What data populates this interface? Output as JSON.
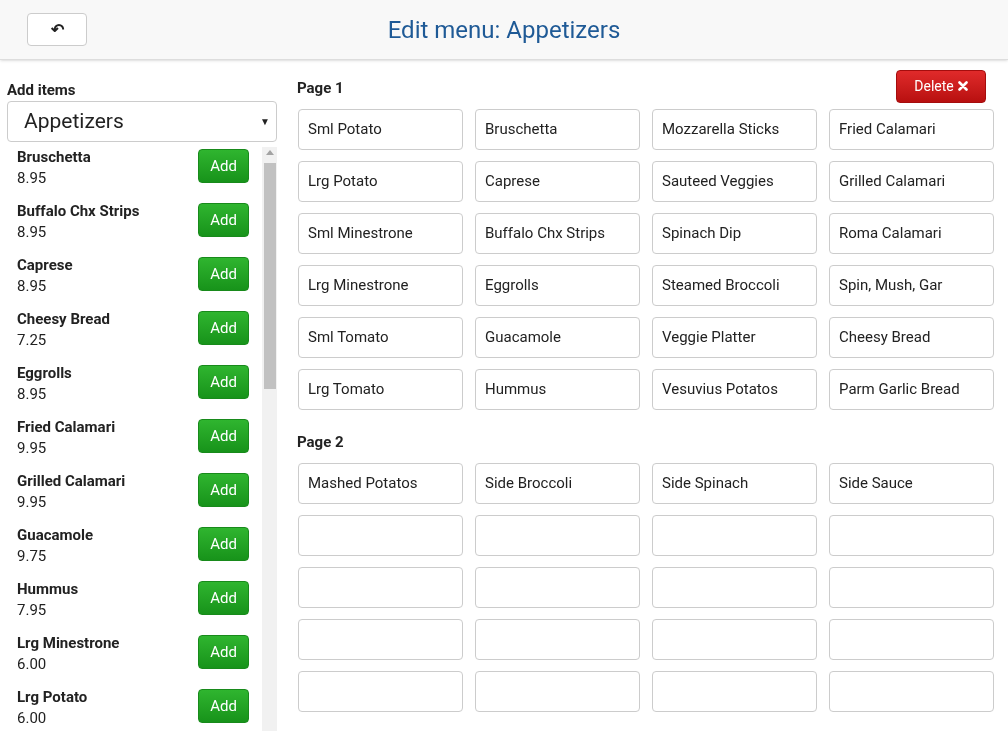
{
  "header": {
    "back_icon": "↶",
    "title": "Edit menu: Appetizers"
  },
  "sidebar": {
    "label": "Add items",
    "category": "Appetizers",
    "caret": "▼",
    "items": [
      {
        "name": "Bruschetta",
        "price": "8.95",
        "add_label": "Add"
      },
      {
        "name": "Buffalo Chx Strips",
        "price": "8.95",
        "add_label": "Add"
      },
      {
        "name": "Caprese",
        "price": "8.95",
        "add_label": "Add"
      },
      {
        "name": "Cheesy Bread",
        "price": "7.25",
        "add_label": "Add"
      },
      {
        "name": "Eggrolls",
        "price": "8.95",
        "add_label": "Add"
      },
      {
        "name": "Fried Calamari",
        "price": "9.95",
        "add_label": "Add"
      },
      {
        "name": "Grilled Calamari",
        "price": "9.95",
        "add_label": "Add"
      },
      {
        "name": "Guacamole",
        "price": "9.75",
        "add_label": "Add"
      },
      {
        "name": "Hummus",
        "price": "7.95",
        "add_label": "Add"
      },
      {
        "name": "Lrg Minestrone",
        "price": "6.00",
        "add_label": "Add"
      },
      {
        "name": "Lrg Potato",
        "price": "6.00",
        "add_label": "Add"
      }
    ]
  },
  "delete_button": {
    "label": "Delete"
  },
  "pages": [
    {
      "title": "Page 1",
      "cells": [
        {
          "kind": "item",
          "label": "Sml Potato"
        },
        {
          "kind": "item",
          "label": "Bruschetta"
        },
        {
          "kind": "item",
          "label": "Mozzarella Sticks"
        },
        {
          "kind": "item",
          "label": "Fried Calamari"
        },
        {
          "kind": "item",
          "label": "Lrg Potato"
        },
        {
          "kind": "item",
          "label": "Caprese"
        },
        {
          "kind": "item",
          "label": "Sauteed Veggies"
        },
        {
          "kind": "item",
          "label": "Grilled Calamari"
        },
        {
          "kind": "item",
          "label": "Sml Minestrone"
        },
        {
          "kind": "item",
          "label": "Buffalo Chx Strips"
        },
        {
          "kind": "item",
          "label": "Spinach Dip"
        },
        {
          "kind": "item",
          "label": "Roma Calamari"
        },
        {
          "kind": "item",
          "label": "Lrg Minestrone"
        },
        {
          "kind": "item",
          "label": "Eggrolls"
        },
        {
          "kind": "item",
          "label": "Steamed Broccoli"
        },
        {
          "kind": "item",
          "label": "Spin, Mush, Gar"
        },
        {
          "kind": "item",
          "label": "Sml Tomato"
        },
        {
          "kind": "item",
          "label": "Guacamole"
        },
        {
          "kind": "item",
          "label": "Veggie Platter"
        },
        {
          "kind": "item",
          "label": "Cheesy Bread"
        },
        {
          "kind": "item",
          "label": "Lrg Tomato"
        },
        {
          "kind": "item",
          "label": "Hummus"
        },
        {
          "kind": "item",
          "label": "Vesuvius Potatos"
        },
        {
          "kind": "item",
          "label": "Parm Garlic Bread"
        }
      ]
    },
    {
      "title": "Page 2",
      "cells": [
        {
          "kind": "item",
          "label": "Mashed Potatos"
        },
        {
          "kind": "item",
          "label": "Side Broccoli"
        },
        {
          "kind": "item",
          "label": "Side Spinach"
        },
        {
          "kind": "item",
          "label": "Side Sauce"
        },
        {
          "kind": "empty"
        },
        {
          "kind": "empty"
        },
        {
          "kind": "empty"
        },
        {
          "kind": "empty"
        },
        {
          "kind": "empty"
        },
        {
          "kind": "empty"
        },
        {
          "kind": "empty"
        },
        {
          "kind": "empty"
        },
        {
          "kind": "empty"
        },
        {
          "kind": "empty"
        },
        {
          "kind": "empty"
        },
        {
          "kind": "empty"
        },
        {
          "kind": "empty"
        },
        {
          "kind": "empty"
        },
        {
          "kind": "empty"
        },
        {
          "kind": "empty"
        }
      ]
    }
  ]
}
